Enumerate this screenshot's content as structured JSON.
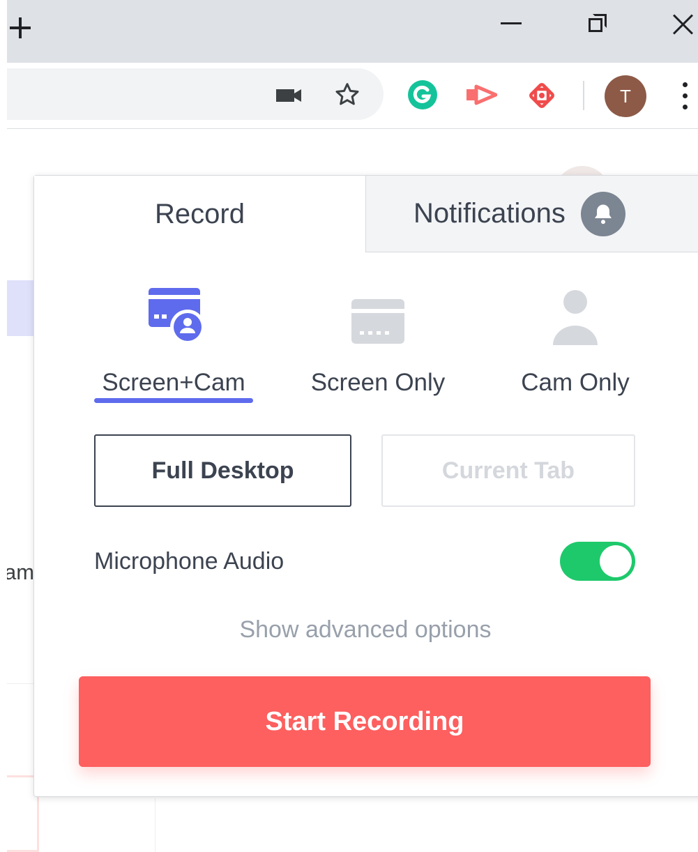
{
  "browser": {
    "new_tab_icon": "plus-icon",
    "window_controls": [
      "minimize-icon",
      "restore-icon",
      "close-icon"
    ],
    "toolbar_icons": [
      "camera-icon",
      "star-icon",
      "grammarly-icon",
      "loom-icon",
      "red-swirl-icon",
      "kebab-menu-icon"
    ],
    "profile_initial": "T",
    "profile_color": "#8d5a47"
  },
  "background_page": {
    "text_fragment": "am"
  },
  "popup": {
    "tabs": [
      {
        "label": "Record",
        "active": true
      },
      {
        "label": "Notifications",
        "active": false,
        "icon": "bell-icon"
      }
    ],
    "modes": [
      {
        "label": "Screen+Cam",
        "icon": "screen-cam-icon",
        "selected": true
      },
      {
        "label": "Screen Only",
        "icon": "screen-icon",
        "selected": false
      },
      {
        "label": "Cam Only",
        "icon": "person-icon",
        "selected": false
      }
    ],
    "capture_options": [
      {
        "label": "Full Desktop",
        "selected": true
      },
      {
        "label": "Current Tab",
        "selected": false
      }
    ],
    "microphone": {
      "label": "Microphone Audio",
      "enabled": true
    },
    "advanced_link": "Show advanced options",
    "start_button": "Start Recording",
    "colors": {
      "accent": "#5f6bed",
      "toggle_on": "#1ec96b",
      "start_button": "#fe5f5f",
      "text": "#3c4350",
      "muted": "#98a0ab"
    }
  }
}
